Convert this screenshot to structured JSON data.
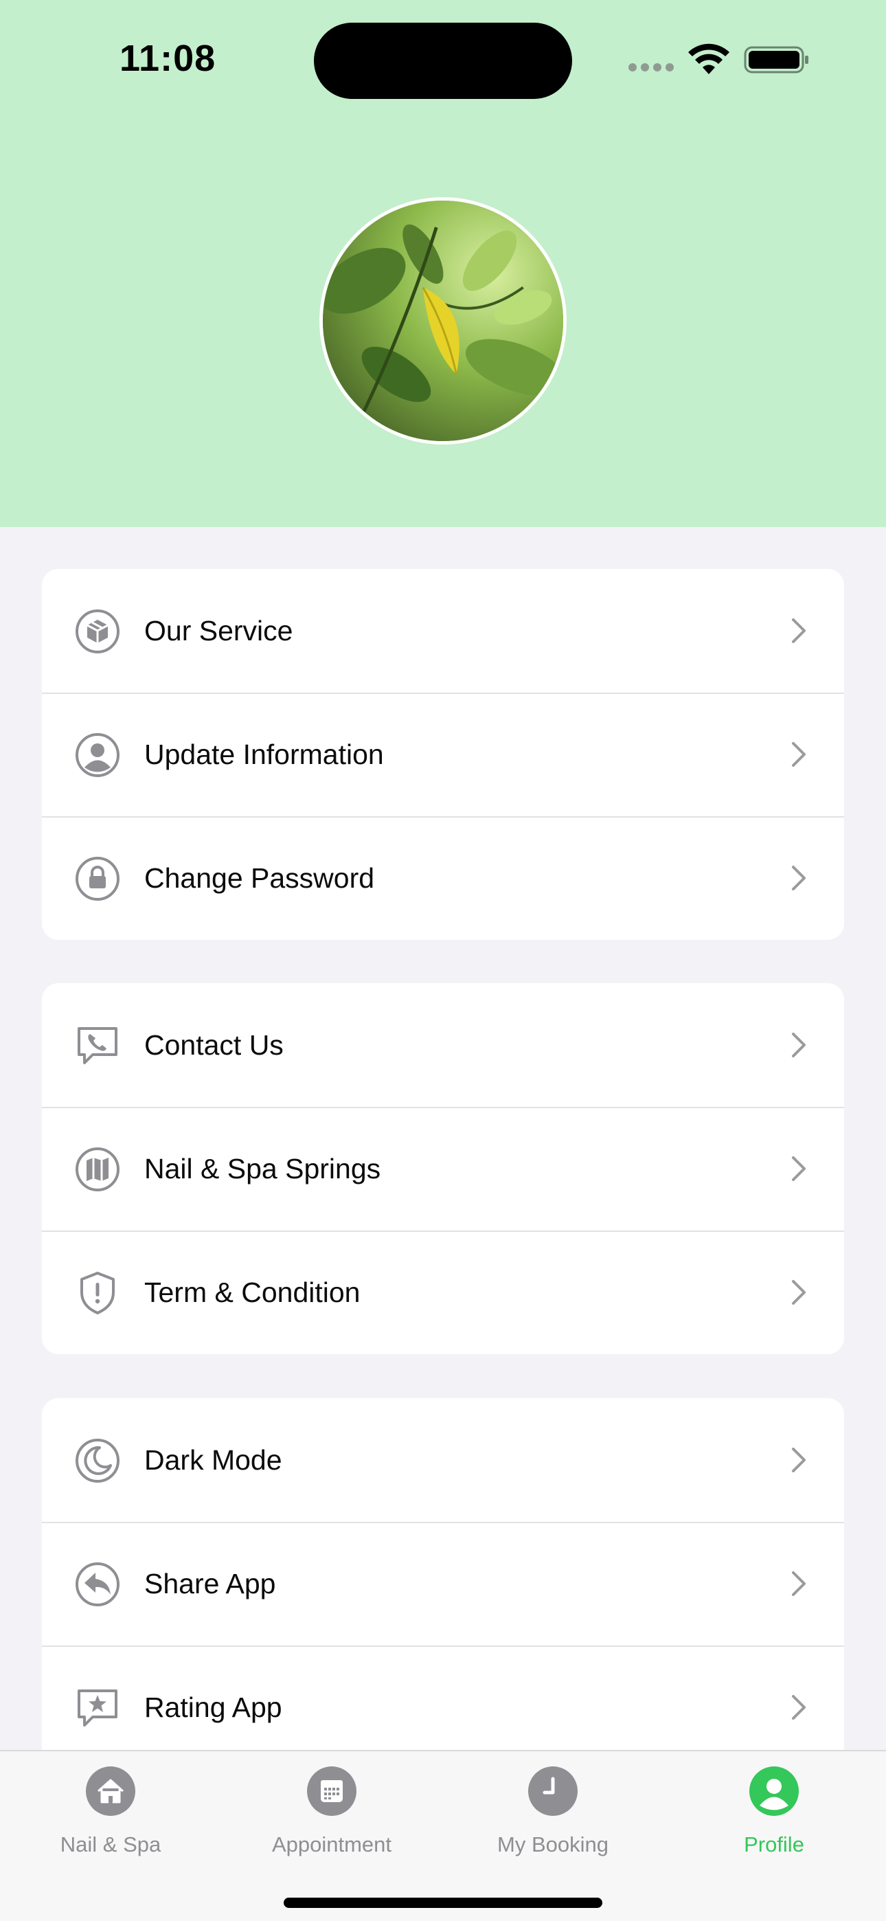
{
  "status_bar": {
    "time": "11:08"
  },
  "profile": {
    "avatar_alt": "leaf photo"
  },
  "menu_groups": [
    [
      {
        "label": "Our Service",
        "icon": "box-icon"
      },
      {
        "label": "Update Information",
        "icon": "person-circle-icon"
      },
      {
        "label": "Change Password",
        "icon": "lock-icon"
      }
    ],
    [
      {
        "label": "Contact Us",
        "icon": "phone-bubble-icon"
      },
      {
        "label": "Nail & Spa Springs",
        "icon": "map-icon"
      },
      {
        "label": "Term & Condition",
        "icon": "shield-exclamation-icon"
      }
    ],
    [
      {
        "label": "Dark Mode",
        "icon": "moon-icon"
      },
      {
        "label": "Share App",
        "icon": "share-arrow-icon"
      },
      {
        "label": "Rating App",
        "icon": "star-bubble-icon"
      }
    ]
  ],
  "tab_bar": {
    "tabs": [
      {
        "label": "Nail & Spa",
        "icon": "house-icon",
        "active": false
      },
      {
        "label": "Appointment",
        "icon": "calendar-icon",
        "active": false
      },
      {
        "label": "My Booking",
        "icon": "clock-icon",
        "active": false
      },
      {
        "label": "Profile",
        "icon": "person-icon",
        "active": true
      }
    ]
  },
  "colors": {
    "header_bg": "#c3efcc",
    "accent": "#34c759",
    "icon_gray": "#8e8e93"
  }
}
